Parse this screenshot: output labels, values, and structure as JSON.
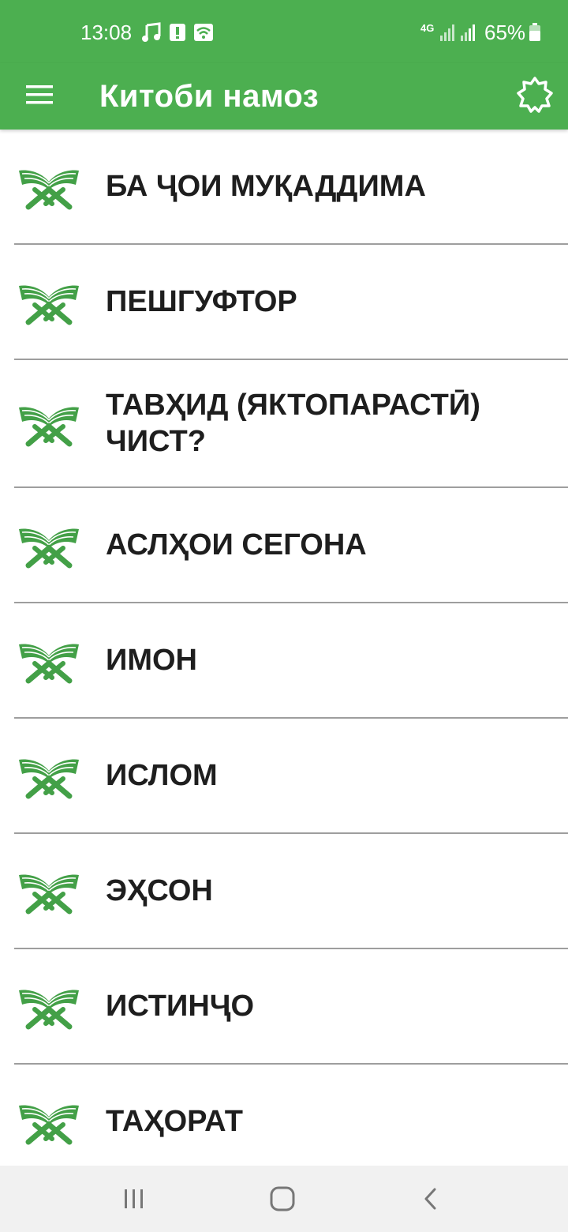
{
  "status_bar": {
    "time": "13:08",
    "network": "4G",
    "battery": "65%",
    "icons": [
      "music-note-icon",
      "alert-icon",
      "wifi-calling-icon",
      "signal-icon",
      "signal-icon",
      "battery-icon"
    ]
  },
  "app_bar": {
    "title": "Китоби намоз",
    "menu_icon": "hamburger-menu-icon",
    "theme_icon": "theme-toggle-icon"
  },
  "list": {
    "items": [
      {
        "label": "БА ҶОИ МУҚАДДИМА"
      },
      {
        "label": "ПЕШГУФТОР"
      },
      {
        "label": "ТАВҲИД (ЯКТОПАРАСТӢ) ЧИСТ?"
      },
      {
        "label": "АСЛҲОИ СЕГОНА"
      },
      {
        "label": "ИМОН"
      },
      {
        "label": "ИСЛОМ"
      },
      {
        "label": "ЭҲСОН"
      },
      {
        "label": "ИСТИНҶО"
      },
      {
        "label": "ТАҲОРАТ"
      }
    ],
    "item_icon": "quran-book-icon"
  },
  "colors": {
    "primary": "#4caf50",
    "icon_green": "#43a047",
    "text": "#1e1e1e",
    "divider": "#9e9e9e",
    "nav_bg": "#f1f1f1"
  },
  "nav_bar": {
    "icons": [
      "recent-apps-icon",
      "home-icon",
      "back-icon"
    ]
  }
}
